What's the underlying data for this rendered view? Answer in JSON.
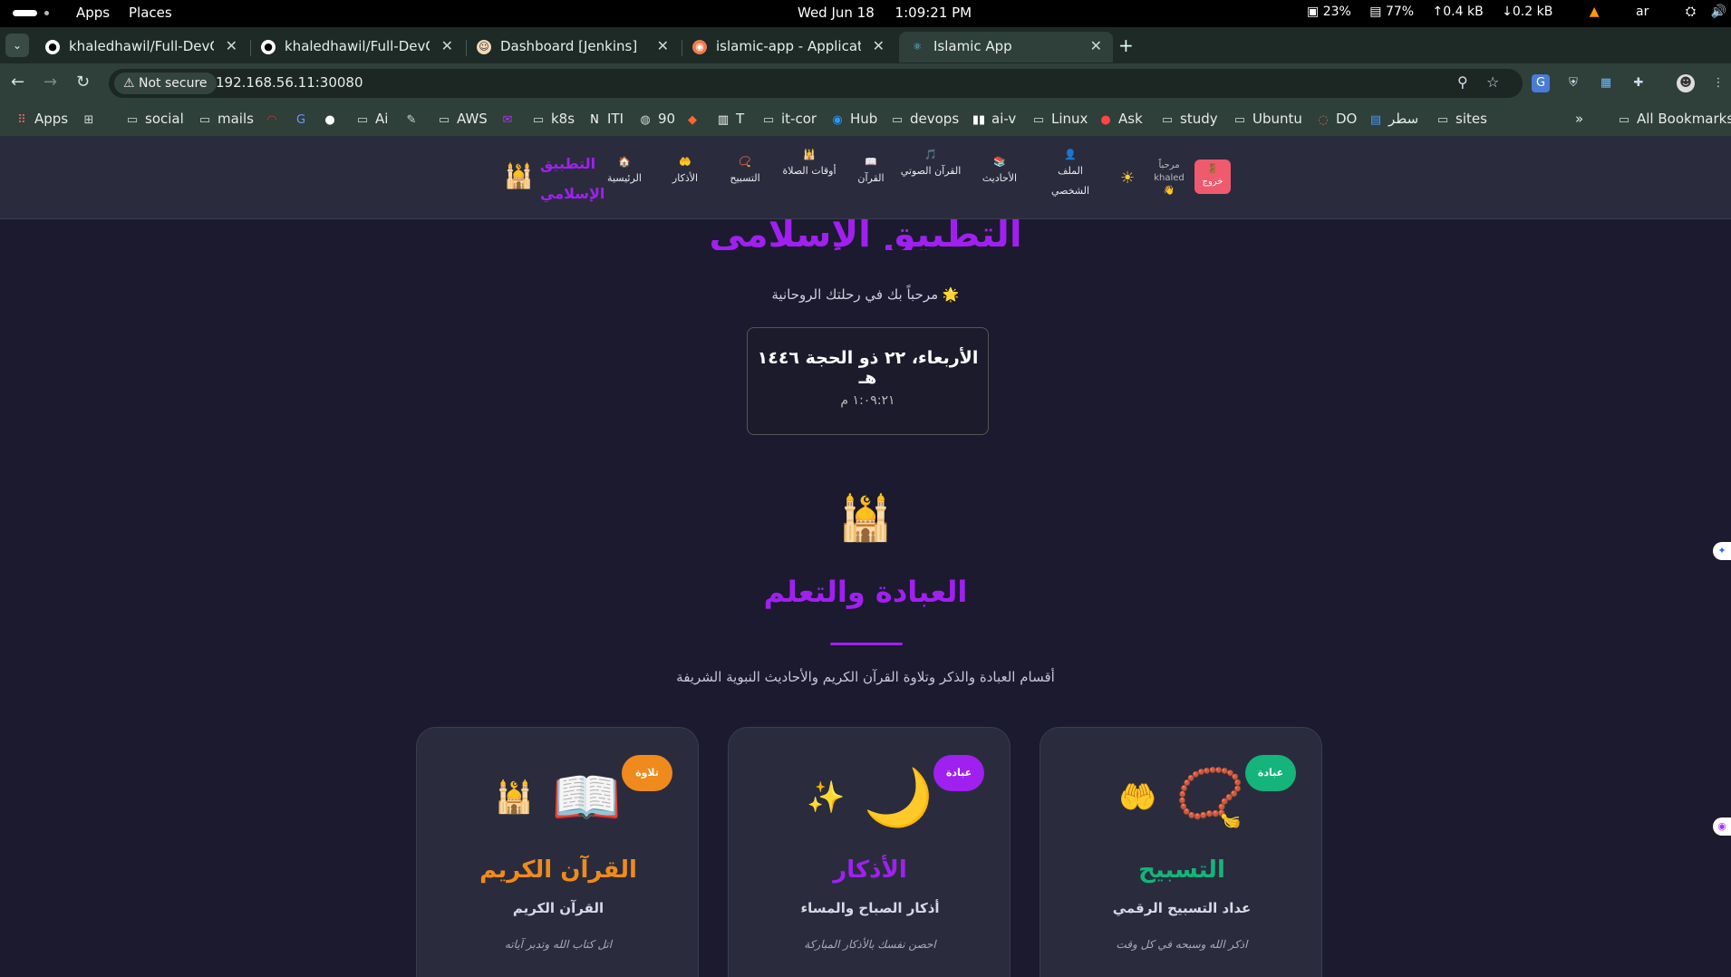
{
  "topbar": {
    "apps": "Apps",
    "places": "Places",
    "date": "Wed Jun 18",
    "time": "1:09:21 PM",
    "cpu": "23%",
    "mem": "77%",
    "up": "0.4 kB",
    "down": "0.2 kB",
    "lang": "ar"
  },
  "tabs": [
    {
      "title": "khaledhawil/Full-DevOps",
      "icon": "github-icon"
    },
    {
      "title": "khaledhawil/Full-DevOps",
      "icon": "github-icon"
    },
    {
      "title": "Dashboard [Jenkins]",
      "icon": "jenkins-icon"
    },
    {
      "title": "islamic-app - Application",
      "icon": "argocd-icon"
    },
    {
      "title": "Islamic App",
      "icon": "react-icon"
    }
  ],
  "toolbar": {
    "not_secure": "Not secure",
    "url": "192.168.56.11:30080"
  },
  "bookmarks": [
    "Apps",
    "social",
    "mails",
    "Ai",
    "AWS",
    "k8s",
    "ITI",
    "90",
    "T",
    "it-cor",
    "Hub",
    "devops",
    "ai-v",
    "Linux",
    "Ask",
    "study",
    "Ubuntu",
    "DO",
    "سطر",
    "sites",
    "All Bookmarks"
  ],
  "appnav": {
    "brand": "التطبيق الإسلامي",
    "items": [
      {
        "icon": "🏠",
        "label": "الرئيسية"
      },
      {
        "icon": "🤲",
        "label": "الأذكار"
      },
      {
        "icon": "📿",
        "label": "التسبيح"
      },
      {
        "icon": "🕌",
        "label": "أوقات الصلاة"
      },
      {
        "icon": "📖",
        "label": "القرآن"
      },
      {
        "icon": "🎵",
        "label": "القرآن الصوتي"
      },
      {
        "icon": "📚",
        "label": "الأحاديث"
      },
      {
        "icon": "👤",
        "label": "الملف الشخصي"
      }
    ],
    "greeting": "مرحباً",
    "username": "khaled",
    "logout": "خروج"
  },
  "hero": {
    "title": "التطبيق الإسلامي",
    "subtitle": "مرحباً بك في رحلتك الروحانية 🌟",
    "date": "الأربعاء، ٢٢ ذو الحجة ١٤٤٦ هـ",
    "time": "١:٠٩:٢١ م"
  },
  "section": {
    "title": "العبادة والتعلم",
    "description": "أقسام العبادة والذكر وتلاوة القرآن الكريم والأحاديث النبوية الشريفة"
  },
  "cards": [
    {
      "badge": "تلاوة",
      "badge_color": "#f08a1c",
      "title": "القرآن الكريم",
      "title_color": "#f08a1c",
      "subtitle": "القرآن الكريم",
      "hint": "اتل كتاب الله وتدبر آياته",
      "icon_big": "📖",
      "icon_small": "🕌"
    },
    {
      "badge": "عبادة",
      "badge_color": "#a020f0",
      "title": "الأذكار",
      "title_color": "#a020f0",
      "subtitle": "أذكار الصباح والمساء",
      "hint": "احصن نفسك بالأذكار المباركة",
      "icon_big": "🌙",
      "icon_small": "✨"
    },
    {
      "badge": "عبادة",
      "badge_color": "#14b47a",
      "title": "التسبيح",
      "title_color": "#14b47a",
      "subtitle": "عداد التسبيح الرقمي",
      "hint": "اذكر الله وسبحه في كل وقت",
      "icon_big": "📿",
      "icon_small": "🤲"
    }
  ]
}
